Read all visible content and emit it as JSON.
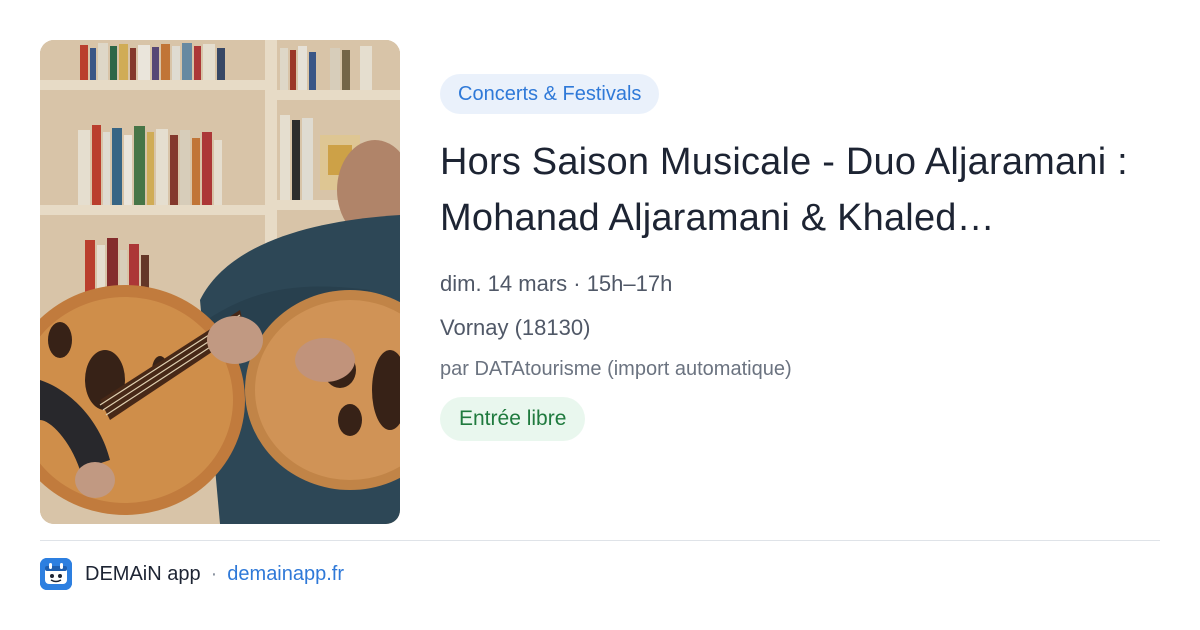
{
  "event": {
    "category": "Concerts & Festivals",
    "title": "Hors Saison Musicale - Duo Aljaramani : Mohanad Aljaramani & Khaled…",
    "date_time": "dim. 14 mars · 15h–17h",
    "location": "Vornay (18130)",
    "organizer": "par DATAtourisme (import automatique)",
    "price": "Entrée libre"
  },
  "footer": {
    "app_name": "DEMAiN app",
    "separator": "·",
    "site": "demainapp.fr"
  },
  "colors": {
    "accent": "#2f79d8",
    "category_bg": "#eaf1fb",
    "price_text": "#1f7a3e",
    "price_bg": "#e9f7ee"
  },
  "icons": {
    "app_logo": "demain-app-icon"
  }
}
